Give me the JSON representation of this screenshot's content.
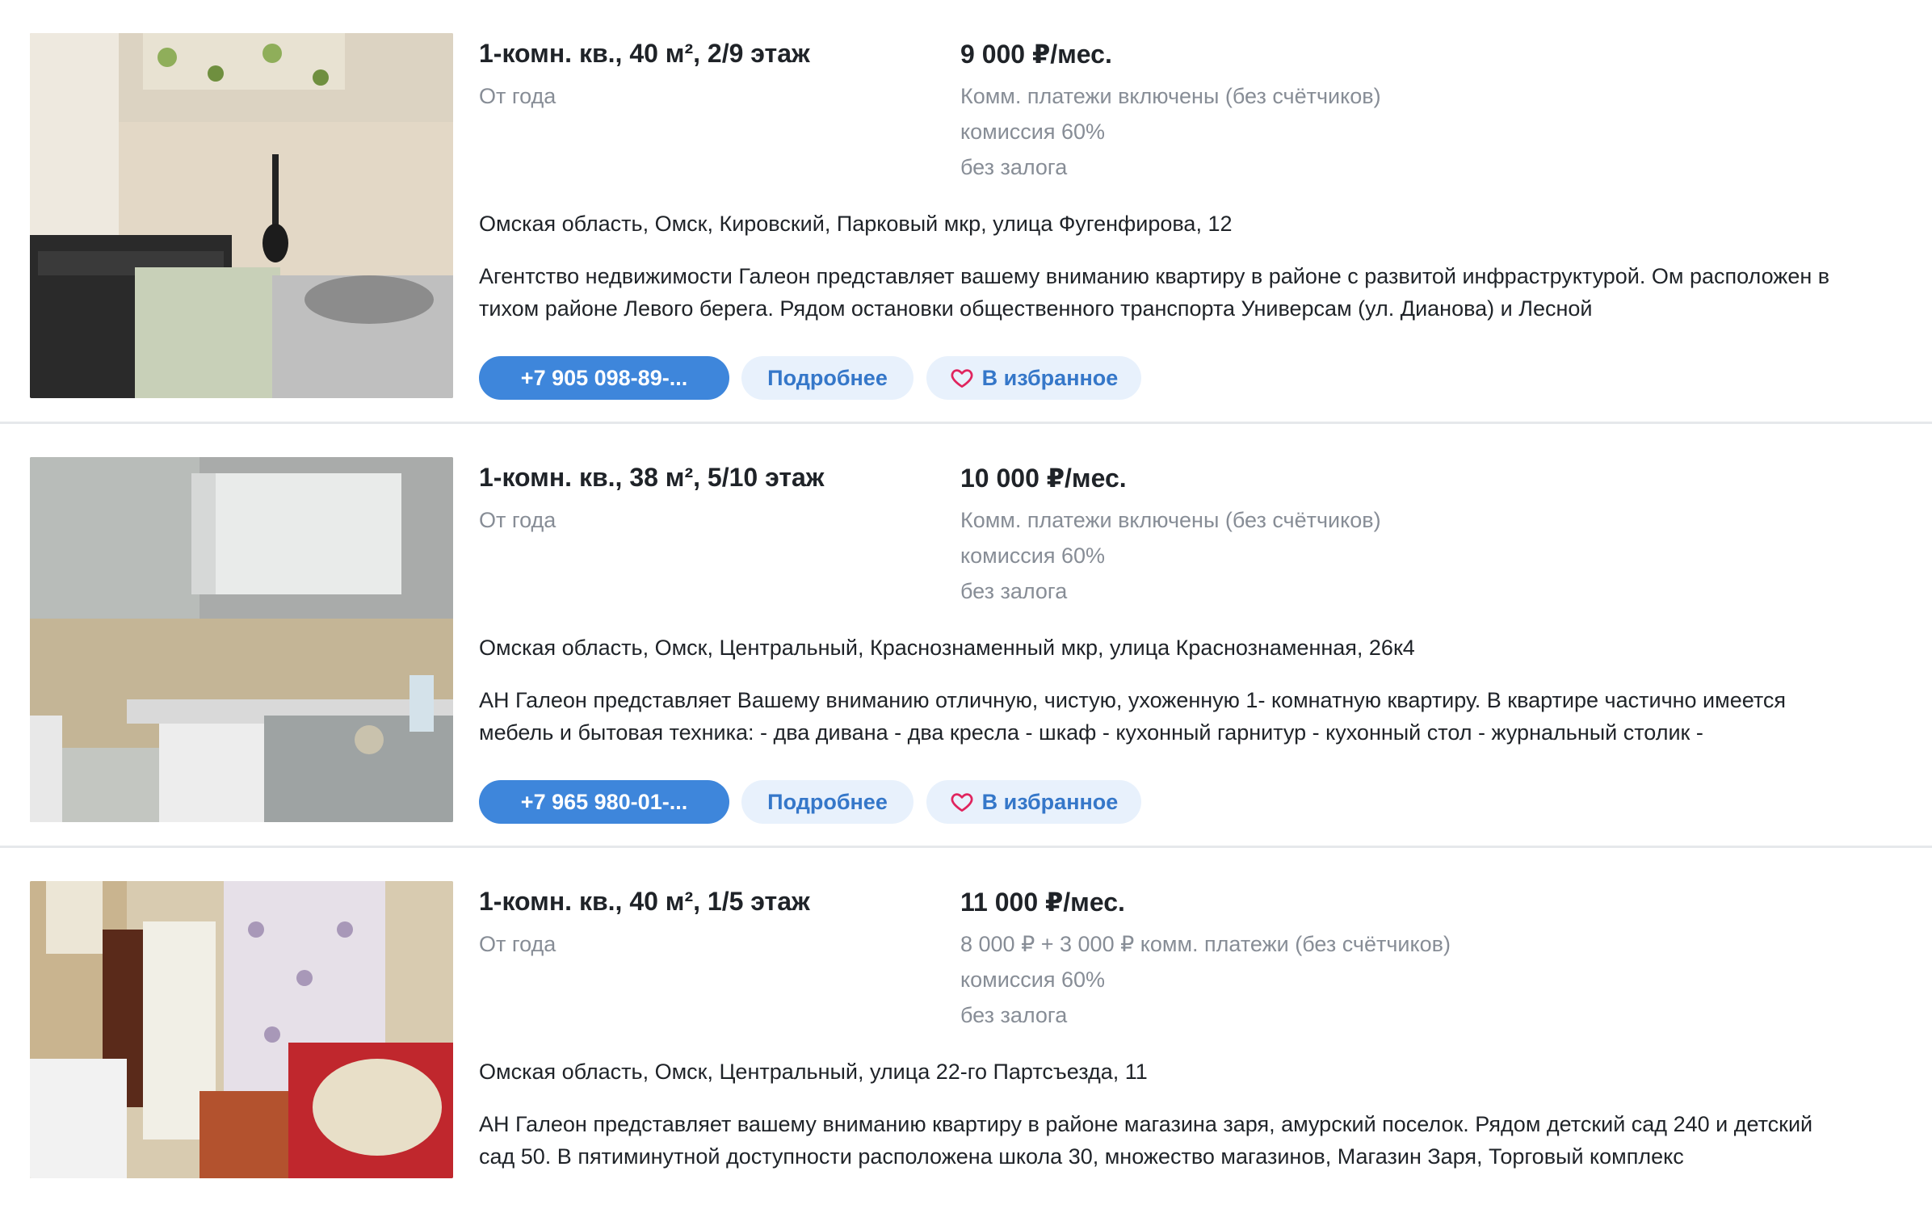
{
  "listings": [
    {
      "title": "1-комн. кв., 40 м², 2/9 этаж",
      "term": "От года",
      "price": "9 000 ₽/мес.",
      "conditions": [
        "Комм. платежи включены (без счётчиков)",
        "комиссия 60%",
        "без залога"
      ],
      "address": "Омская область, Омск, Кировский, Парковый мкр, улица Фугенфирова, 12",
      "description": "Агентство недвижимости Галеон представляет вашему вниманию квартиру в районе с развитой инфраструктурой. Ом расположен в тихом районе Левого берега. Рядом остановки общественного транспорта Универсам (ул. Дианова) и Лесной",
      "phone": "+7 905 098-89-...",
      "details": "Подробнее",
      "favorite": "В избранное"
    },
    {
      "title": "1-комн. кв., 38 м², 5/10 этаж",
      "term": "От года",
      "price": "10 000 ₽/мес.",
      "conditions": [
        "Комм. платежи включены (без счётчиков)",
        "комиссия 60%",
        "без залога"
      ],
      "address": "Омская область, Омск, Центральный, Краснознаменный мкр, улица Краснознаменная, 26к4",
      "description": "АН Галеон представляет Вашему вниманию отличную, чистую, ухоженную 1- комнатную квартиру. В квартире частично имеется мебель и бытовая техника: - два дивана - два кресла - шкаф - кухонный гарнитур - кухонный стол - журнальный столик -",
      "phone": "+7 965 980-01-...",
      "details": "Подробнее",
      "favorite": "В избранное"
    },
    {
      "title": "1-комн. кв., 40 м², 1/5 этаж",
      "term": "От года",
      "price": "11 000 ₽/мес.",
      "conditions": [
        "8 000 ₽ + 3 000 ₽ комм. платежи (без счётчиков)",
        "комиссия 60%",
        "без залога"
      ],
      "address": "Омская область, Омск, Центральный, улица 22-го Партсъезда, 11",
      "description": "АН Галеон представляет вашему вниманию квартиру в районе магазина заря, амурский поселок. Рядом детский сад 240 и детский сад 50. В пятиминутной доступности расположена школа 30, множество магазинов, Магазин Заря, Торговый комплекс"
    }
  ],
  "icons": {
    "favorite": "heart-icon"
  },
  "colors": {
    "primary": "#3e86db",
    "secondary_bg": "#e8f1fc",
    "heart": "#e0245e",
    "muted_text": "#878d96"
  }
}
